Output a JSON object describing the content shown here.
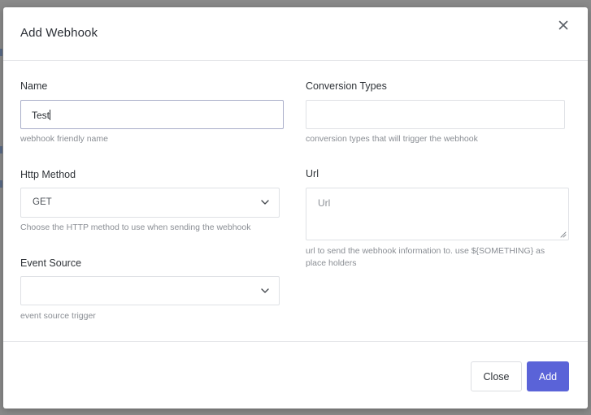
{
  "modal": {
    "title": "Add Webhook",
    "close_icon": "close-icon"
  },
  "fields": {
    "name": {
      "label": "Name",
      "value": "Test",
      "help": "webhook friendly name"
    },
    "conversion_types": {
      "label": "Conversion Types",
      "value": "",
      "help": "conversion types that will trigger the webhook"
    },
    "http_method": {
      "label": "Http Method",
      "selected": "GET",
      "help": "Choose the HTTP method to use when sending the webhook",
      "icon": "chevron-down-icon"
    },
    "url": {
      "label": "Url",
      "placeholder": "Url",
      "help_line1": "url to send the webhook information to. use ${SOMETHING} as",
      "help_line2": "place holders"
    },
    "event_source": {
      "label": "Event Source",
      "selected": "",
      "help": "event source trigger",
      "icon": "chevron-down-icon"
    }
  },
  "footer": {
    "close_label": "Close",
    "add_label": "Add"
  },
  "colors": {
    "primary": "#5a63d8",
    "backdrop": "#8a8a8a"
  }
}
